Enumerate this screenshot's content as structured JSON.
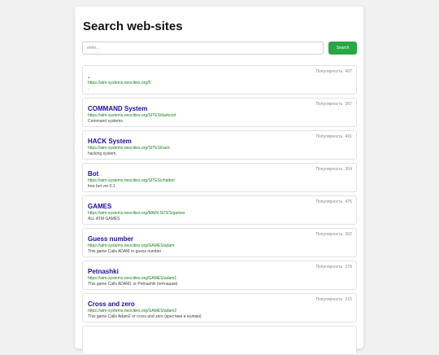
{
  "header": {
    "title": "Search web-sites"
  },
  "search": {
    "placeholder": "enter...",
    "button_label": "Search"
  },
  "popularity_label": "Популярность:",
  "results": [
    {
      "title": ".",
      "url": "https://atm-systems.neocities.org/5",
      "desc": ".",
      "popularity": "407"
    },
    {
      "title": "COMMAND System",
      "url": "https://atm-systems.neocities.org/SITES/darkcod",
      "desc": "Command systems.",
      "popularity": "367"
    },
    {
      "title": "HACK System",
      "url": "https://atm-systems.neocities.org/SITES/hack",
      "desc": "hacking system.",
      "popularity": "491"
    },
    {
      "title": "Bot",
      "url": "https://atm-systems.neocities.org/SITES/chatbot",
      "desc": "free bot ver 0.1",
      "popularity": "304"
    },
    {
      "title": "GAMES",
      "url": "https://atm-systems.neocities.org/MAIN-SITES/games",
      "desc": "ALL ATM GAMES",
      "popularity": "476"
    },
    {
      "title": "Guess number",
      "url": "https://atm-systems.neocities.org/GAMES/adam",
      "desc": "This game Calls ADAM or guess number",
      "popularity": "302"
    },
    {
      "title": "Petnashki",
      "url": "https://atm-systems.neocities.org/GAMES/adam1",
      "desc": "This game Calls ADAM1 or Petnashki (пятнашки)",
      "popularity": "278"
    },
    {
      "title": "Cross and zero",
      "url": "https://atm-systems.neocities.org/GAMES/adam2",
      "desc": "This game Calls Adam2 or cross and zero (крестики и нолики)",
      "popularity": "215"
    },
    {
      "title": "",
      "url": "",
      "desc": "",
      "popularity": ""
    }
  ]
}
